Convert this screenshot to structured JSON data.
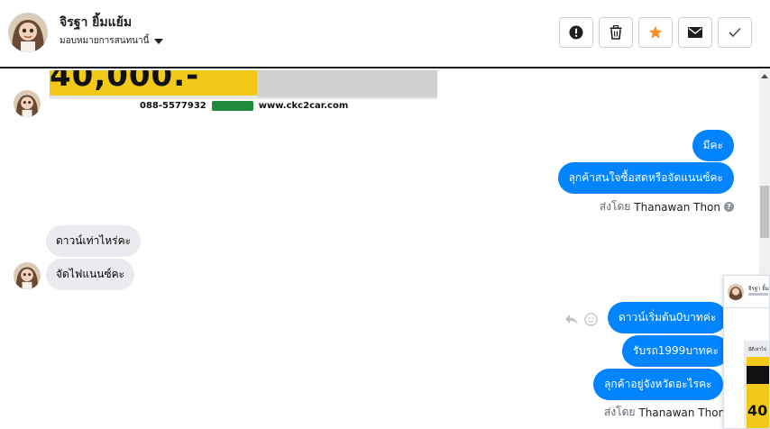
{
  "header": {
    "contact_name": "จิรฐา ยิ้มแย้ม",
    "assign_label": "มอบหมายการสนทนานี้",
    "actions": [
      {
        "name": "mark-spam-button",
        "icon": "exclamation-circle-icon"
      },
      {
        "name": "delete-button",
        "icon": "trash-icon"
      },
      {
        "name": "star-button",
        "icon": "star-icon",
        "color": "#f5902a"
      },
      {
        "name": "mark-unread-button",
        "icon": "envelope-icon"
      },
      {
        "name": "mark-done-button",
        "icon": "checkmark-icon"
      }
    ]
  },
  "banner": {
    "big_number": "40,000.-",
    "phone": "088-5577932",
    "website": "www.ckc2car.com"
  },
  "messages": [
    {
      "direction": "out",
      "text": "มีคะ"
    },
    {
      "direction": "out",
      "text": "ลุกค้าสนใจซื้อสดหรือจัดแนนซ์คะ"
    },
    {
      "direction": "in",
      "text": "ดาวน์เท่าไหร่คะ"
    },
    {
      "direction": "in",
      "text": "จัดไฟแนนซ์คะ"
    },
    {
      "direction": "out",
      "text": "ดาวน์เริ่มต้น0บาทค่ะ"
    },
    {
      "direction": "out",
      "text": "รับรถ1999บาทคะ"
    },
    {
      "direction": "out",
      "text": "ลุกค้าอยู่จังหวัดอะไรคะ"
    }
  ],
  "sent_by": {
    "prefix": "ส่งโดย",
    "agent": "Thanawan Thon"
  },
  "preview": {
    "name": "จิรฐา ยิ้ม",
    "label": "มีดีเท่าไป"
  },
  "colors": {
    "accent": "#0084ff",
    "incoming_bubble": "#e9ebee",
    "star": "#f5902a"
  }
}
